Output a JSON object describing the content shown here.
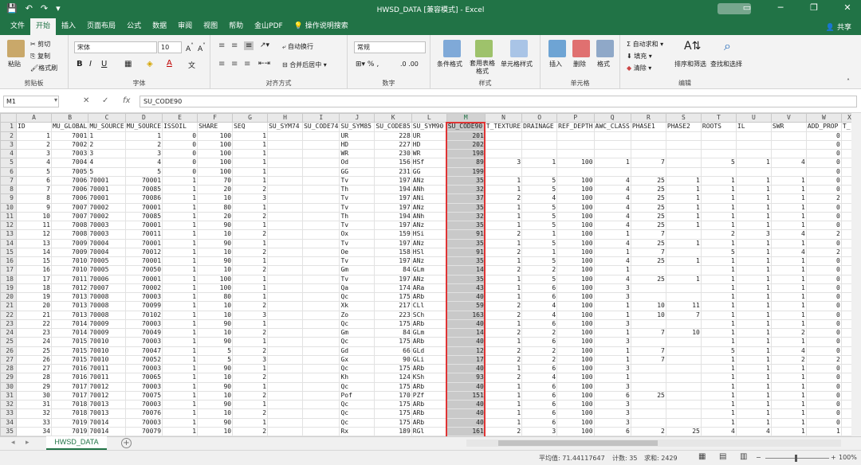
{
  "window": {
    "title": "HWSD_DATA  [兼容模式]  -  Excel",
    "save_icon": "save-icon",
    "controls": [
      "▭",
      "─",
      "❐",
      "✕"
    ]
  },
  "menu": {
    "items": [
      "文件",
      "开始",
      "插入",
      "页面布局",
      "公式",
      "数据",
      "审阅",
      "视图",
      "帮助",
      "金山PDF",
      "操作说明搜索"
    ],
    "active": "开始",
    "share": "共享"
  },
  "ribbon": {
    "clipboard": {
      "paste": "粘贴",
      "cut": "剪切",
      "copy": "复制",
      "format_painter": "格式刷",
      "label": "剪贴板"
    },
    "font": {
      "name": "宋体",
      "size": "10",
      "label": "字体",
      "bold": "B",
      "italic": "I",
      "underline": "U"
    },
    "alignment": {
      "wrap": "自动换行",
      "merge": "合并后居中",
      "label": "对齐方式"
    },
    "number": {
      "format": "常规",
      "label": "数字"
    },
    "styles": {
      "conditional": "条件格式",
      "table": "套用表格格式",
      "cell_styles": "单元格样式",
      "label": "样式"
    },
    "cells": {
      "insert": "插入",
      "delete": "删除",
      "format": "格式",
      "label": "单元格"
    },
    "editing": {
      "autosum": "自动求和",
      "fill": "填充",
      "clear": "清除",
      "sort": "排序和筛选",
      "find": "查找和选择",
      "label": "编辑"
    }
  },
  "formula_bar": {
    "name_box": "M1",
    "cancel": "✕",
    "confirm": "✓",
    "fx": "fx",
    "value": "SU_CODE90"
  },
  "columns": [
    "A",
    "B",
    "C",
    "D",
    "E",
    "F",
    "G",
    "H",
    "I",
    "J",
    "K",
    "L",
    "M",
    "N",
    "O",
    "P",
    "Q",
    "R",
    "S",
    "T",
    "U",
    "V",
    "W",
    "X"
  ],
  "selected_column": "M",
  "rows": [
    [
      "ID",
      "MU_GLOBAL",
      "MU_SOURCE",
      "MU_SOURCE",
      "ISSOIL",
      "SHARE",
      "SEQ",
      "SU_SYM74",
      "SU_CODE74",
      "SU_SYM85",
      "SU_CODE85",
      "SU_SYM90",
      "SU_CODE90",
      "T_TEXTURE",
      "DRAINAGE",
      "REF_DEPTH",
      "AWC_CLASS",
      "PHASE1",
      "PHASE2",
      "ROOTS",
      "IL",
      "SWR",
      "ADD_PROP",
      "T_"
    ],
    [
      "1",
      "7001",
      "1",
      "1",
      "0",
      "100",
      "1",
      "",
      "",
      "UR",
      "228",
      "UR",
      "201",
      "",
      "",
      "",
      "",
      "",
      "",
      "",
      "",
      "",
      "0",
      ""
    ],
    [
      "2",
      "7002",
      "2",
      "2",
      "0",
      "100",
      "1",
      "",
      "",
      "HD",
      "227",
      "HD",
      "202",
      "",
      "",
      "",
      "",
      "",
      "",
      "",
      "",
      "",
      "0",
      ""
    ],
    [
      "3",
      "7003",
      "3",
      "3",
      "0",
      "100",
      "1",
      "",
      "",
      "WR",
      "230",
      "WR",
      "198",
      "",
      "",
      "",
      "",
      "",
      "",
      "",
      "",
      "",
      "0",
      ""
    ],
    [
      "4",
      "7004",
      "4",
      "4",
      "0",
      "100",
      "1",
      "",
      "",
      "Od",
      "156",
      "HSf",
      "89",
      "3",
      "1",
      "100",
      "1",
      "7",
      "",
      "5",
      "1",
      "4",
      "0",
      ""
    ],
    [
      "5",
      "7005",
      "5",
      "5",
      "0",
      "100",
      "1",
      "",
      "",
      "GG",
      "231",
      "GG",
      "199",
      "",
      "",
      "",
      "",
      "",
      "",
      "",
      "",
      "",
      "0",
      ""
    ],
    [
      "6",
      "7006",
      "70001",
      "70001",
      "1",
      "70",
      "1",
      "",
      "",
      "Tv",
      "197",
      "ANz",
      "35",
      "1",
      "5",
      "100",
      "4",
      "25",
      "1",
      "1",
      "1",
      "1",
      "0",
      ""
    ],
    [
      "7",
      "7006",
      "70001",
      "70085",
      "1",
      "20",
      "2",
      "",
      "",
      "Th",
      "194",
      "ANh",
      "32",
      "1",
      "5",
      "100",
      "4",
      "25",
      "1",
      "1",
      "1",
      "1",
      "0",
      ""
    ],
    [
      "8",
      "7006",
      "70001",
      "70086",
      "1",
      "10",
      "3",
      "",
      "",
      "Tv",
      "197",
      "ANi",
      "37",
      "2",
      "4",
      "100",
      "4",
      "25",
      "1",
      "1",
      "1",
      "1",
      "2",
      ""
    ],
    [
      "9",
      "7007",
      "70002",
      "70001",
      "1",
      "80",
      "1",
      "",
      "",
      "Tv",
      "197",
      "ANz",
      "35",
      "1",
      "5",
      "100",
      "4",
      "25",
      "1",
      "1",
      "1",
      "1",
      "0",
      ""
    ],
    [
      "10",
      "7007",
      "70002",
      "70085",
      "1",
      "20",
      "2",
      "",
      "",
      "Th",
      "194",
      "ANh",
      "32",
      "1",
      "5",
      "100",
      "4",
      "25",
      "1",
      "1",
      "1",
      "1",
      "0",
      ""
    ],
    [
      "11",
      "7008",
      "70003",
      "70001",
      "1",
      "90",
      "1",
      "",
      "",
      "Tv",
      "197",
      "ANz",
      "35",
      "1",
      "5",
      "100",
      "4",
      "25",
      "1",
      "1",
      "1",
      "1",
      "0",
      ""
    ],
    [
      "12",
      "7008",
      "70003",
      "70011",
      "1",
      "10",
      "2",
      "",
      "",
      "Ox",
      "159",
      "HSi",
      "91",
      "2",
      "1",
      "100",
      "1",
      "7",
      "",
      "2",
      "3",
      "4",
      "2",
      ""
    ],
    [
      "13",
      "7009",
      "70004",
      "70001",
      "1",
      "90",
      "1",
      "",
      "",
      "Tv",
      "197",
      "ANz",
      "35",
      "1",
      "5",
      "100",
      "4",
      "25",
      "1",
      "1",
      "1",
      "1",
      "0",
      ""
    ],
    [
      "14",
      "7009",
      "70004",
      "70012",
      "1",
      "10",
      "2",
      "",
      "",
      "Oe",
      "158",
      "HSl",
      "91",
      "2",
      "1",
      "100",
      "1",
      "7",
      "",
      "5",
      "1",
      "4",
      "2",
      ""
    ],
    [
      "15",
      "7010",
      "70005",
      "70001",
      "1",
      "90",
      "1",
      "",
      "",
      "Tv",
      "197",
      "ANz",
      "35",
      "1",
      "5",
      "100",
      "4",
      "25",
      "1",
      "1",
      "1",
      "1",
      "0",
      ""
    ],
    [
      "16",
      "7010",
      "70005",
      "70050",
      "1",
      "10",
      "2",
      "",
      "",
      "Gm",
      "84",
      "GLm",
      "14",
      "2",
      "2",
      "100",
      "1",
      "",
      "",
      "1",
      "1",
      "1",
      "0",
      ""
    ],
    [
      "17",
      "7011",
      "70006",
      "70001",
      "1",
      "100",
      "1",
      "",
      "",
      "Tv",
      "197",
      "ANz",
      "35",
      "1",
      "5",
      "100",
      "4",
      "25",
      "1",
      "1",
      "1",
      "1",
      "0",
      ""
    ],
    [
      "18",
      "7012",
      "70007",
      "70002",
      "1",
      "100",
      "1",
      "",
      "",
      "Qa",
      "174",
      "ARa",
      "43",
      "1",
      "6",
      "100",
      "3",
      "",
      "",
      "1",
      "1",
      "1",
      "0",
      ""
    ],
    [
      "19",
      "7013",
      "70008",
      "70003",
      "1",
      "80",
      "1",
      "",
      "",
      "Qc",
      "175",
      "ARb",
      "40",
      "1",
      "6",
      "100",
      "3",
      "",
      "",
      "1",
      "1",
      "1",
      "0",
      ""
    ],
    [
      "20",
      "7013",
      "70008",
      "70099",
      "1",
      "10",
      "2",
      "",
      "",
      "Xk",
      "217",
      "CLl",
      "59",
      "2",
      "4",
      "100",
      "1",
      "10",
      "11",
      "1",
      "1",
      "1",
      "0",
      ""
    ],
    [
      "21",
      "7013",
      "70008",
      "70102",
      "1",
      "10",
      "3",
      "",
      "",
      "Zo",
      "223",
      "SCh",
      "163",
      "2",
      "4",
      "100",
      "1",
      "10",
      "7",
      "1",
      "1",
      "1",
      "0",
      ""
    ],
    [
      "22",
      "7014",
      "70009",
      "70003",
      "1",
      "90",
      "1",
      "",
      "",
      "Qc",
      "175",
      "ARb",
      "40",
      "1",
      "6",
      "100",
      "3",
      "",
      "",
      "1",
      "1",
      "1",
      "0",
      ""
    ],
    [
      "23",
      "7014",
      "70009",
      "70049",
      "1",
      "10",
      "2",
      "",
      "",
      "Gm",
      "84",
      "GLm",
      "14",
      "2",
      "2",
      "100",
      "1",
      "7",
      "10",
      "1",
      "1",
      "2",
      "0",
      ""
    ],
    [
      "24",
      "7015",
      "70010",
      "70003",
      "1",
      "90",
      "1",
      "",
      "",
      "Qc",
      "175",
      "ARb",
      "40",
      "1",
      "6",
      "100",
      "3",
      "",
      "",
      "1",
      "1",
      "1",
      "0",
      ""
    ],
    [
      "25",
      "7015",
      "70010",
      "70047",
      "1",
      "5",
      "2",
      "",
      "",
      "Gd",
      "66",
      "GLd",
      "12",
      "2",
      "2",
      "100",
      "1",
      "7",
      "",
      "5",
      "1",
      "4",
      "0",
      ""
    ],
    [
      "26",
      "7015",
      "70010",
      "70052",
      "1",
      "5",
      "3",
      "",
      "",
      "Gx",
      "90",
      "GLi",
      "17",
      "2",
      "2",
      "100",
      "1",
      "7",
      "",
      "1",
      "1",
      "2",
      "2",
      ""
    ],
    [
      "27",
      "7016",
      "70011",
      "70003",
      "1",
      "90",
      "1",
      "",
      "",
      "Qc",
      "175",
      "ARb",
      "40",
      "1",
      "6",
      "100",
      "3",
      "",
      "",
      "1",
      "1",
      "1",
      "0",
      ""
    ],
    [
      "28",
      "7016",
      "70011",
      "70065",
      "1",
      "10",
      "2",
      "",
      "",
      "Kh",
      "124",
      "KSh",
      "93",
      "2",
      "4",
      "100",
      "1",
      "",
      "",
      "1",
      "1",
      "1",
      "0",
      ""
    ],
    [
      "29",
      "7017",
      "70012",
      "70003",
      "1",
      "90",
      "1",
      "",
      "",
      "Qc",
      "175",
      "ARb",
      "40",
      "1",
      "6",
      "100",
      "3",
      "",
      "",
      "1",
      "1",
      "1",
      "0",
      ""
    ],
    [
      "30",
      "7017",
      "70012",
      "70075",
      "1",
      "10",
      "2",
      "",
      "",
      "Pof",
      "170",
      "PZf",
      "151",
      "1",
      "6",
      "100",
      "6",
      "25",
      "",
      "1",
      "1",
      "1",
      "0",
      ""
    ],
    [
      "31",
      "7018",
      "70013",
      "70003",
      "1",
      "90",
      "1",
      "",
      "",
      "Qc",
      "175",
      "ARb",
      "40",
      "1",
      "6",
      "100",
      "3",
      "",
      "",
      "1",
      "1",
      "1",
      "0",
      ""
    ],
    [
      "32",
      "7018",
      "70013",
      "70076",
      "1",
      "10",
      "2",
      "",
      "",
      "Qc",
      "175",
      "ARb",
      "40",
      "1",
      "6",
      "100",
      "3",
      "",
      "",
      "1",
      "1",
      "1",
      "0",
      ""
    ],
    [
      "33",
      "7019",
      "70014",
      "70003",
      "1",
      "90",
      "1",
      "",
      "",
      "Qc",
      "175",
      "ARb",
      "40",
      "1",
      "6",
      "100",
      "3",
      "",
      "",
      "1",
      "1",
      "1",
      "0",
      ""
    ],
    [
      "34",
      "7019",
      "70014",
      "70079",
      "1",
      "10",
      "2",
      "",
      "",
      "Rx",
      "189",
      "RGl",
      "161",
      "2",
      "3",
      "100",
      "6",
      "2",
      "25",
      "4",
      "4",
      "1",
      "1",
      ""
    ]
  ],
  "sheet_tab": "HWSD_DATA",
  "status": {
    "average": "平均值: 71.44117647",
    "count": "计数: 35",
    "sum": "求和: 2429",
    "zoom": "100%"
  }
}
